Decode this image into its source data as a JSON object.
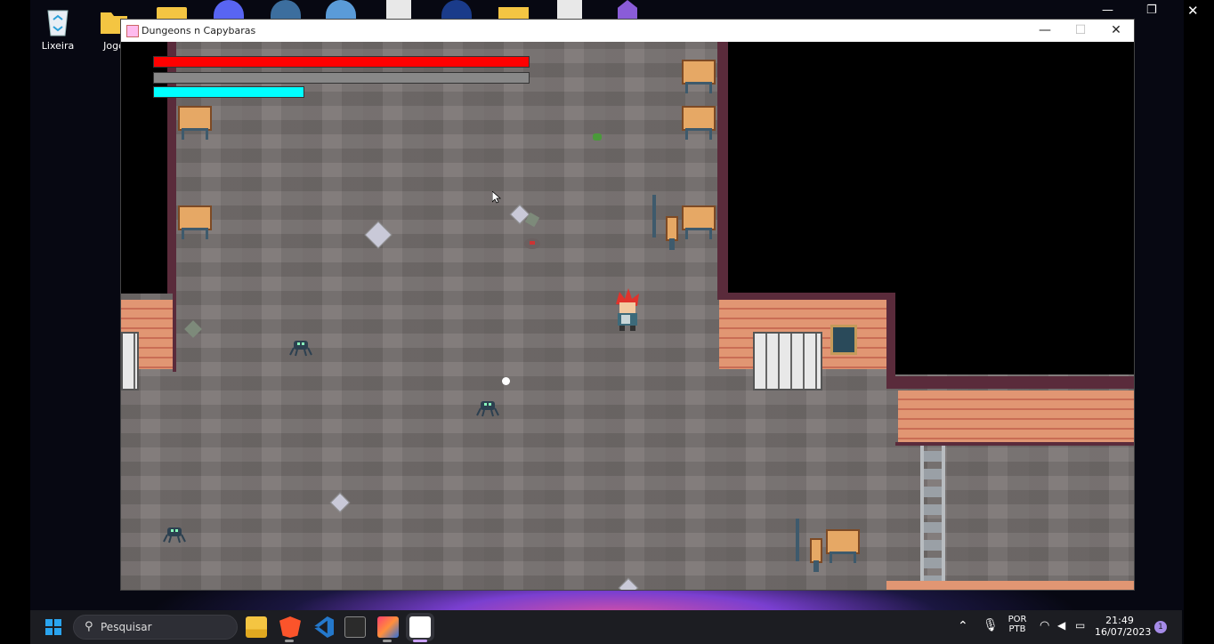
{
  "desktop": {
    "icons": [
      {
        "label": "Lixeira",
        "icon": "recycle-bin-icon"
      },
      {
        "label": "Jogo",
        "icon": "folder-icon"
      }
    ]
  },
  "window": {
    "title": "Dungeons n Capybaras",
    "controls": {
      "minimize": "—",
      "maximize": "☐",
      "close": "✕"
    }
  },
  "game": {
    "hud": {
      "health_fill": 1.0,
      "stamina_fill": 0.0,
      "mana_fill": 0.4,
      "colors": {
        "health": "#ff0000",
        "stamina": "#888888",
        "mana": "#00ffff"
      }
    }
  },
  "taskbar": {
    "search_placeholder": "Pesquisar",
    "apps": [
      "file-explorer-icon",
      "brave-browser-icon",
      "vscode-icon",
      "terminal-icon",
      "intellij-icon",
      "java-icon"
    ],
    "language": "POR",
    "keyboard": "PTB",
    "time": "21:49",
    "date": "16/07/2023",
    "notification_count": "1"
  }
}
